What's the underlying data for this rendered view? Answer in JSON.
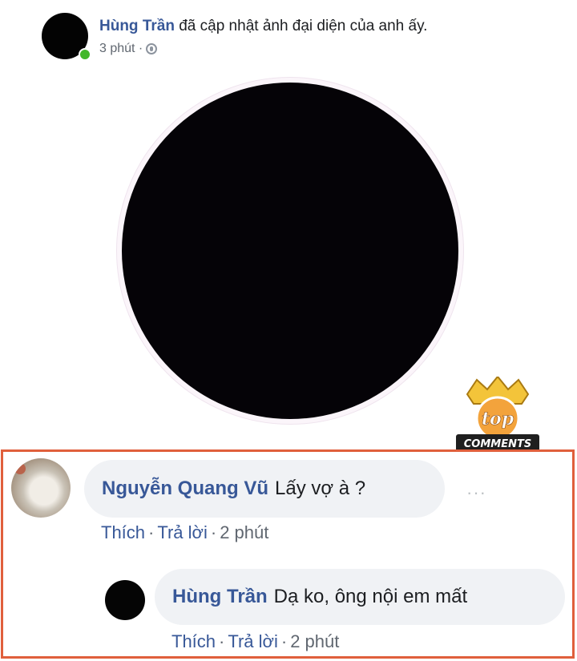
{
  "post": {
    "author": "Hùng Trần",
    "action_text": " đã cập nhật ảnh đại diện của anh ấy.",
    "time": "3 phút ·",
    "privacy_icon": "globe-icon"
  },
  "badge": {
    "line1": "top",
    "line2": "COMMENTS",
    "colors": {
      "crown": "#f3c43a",
      "circle": "#f3a33c",
      "ribbon": "#1f1f1f"
    }
  },
  "comment": {
    "author": "Nguyễn Quang Vũ",
    "text": "Lấy vợ à ?",
    "more": "···",
    "like": "Thích",
    "sep": "·",
    "reply": "Trả lời",
    "time": "2 phút"
  },
  "reply": {
    "author": "Hùng Trần",
    "text": "Dạ ko, ông nội em mất",
    "like": "Thích",
    "sep": "·",
    "reply": "Trả lời",
    "time": "2 phút"
  },
  "colors": {
    "link": "#385898",
    "meta": "#606770",
    "bubble": "#f0f2f5",
    "online": "#42b72a",
    "highlight_border": "#e05f3c"
  }
}
